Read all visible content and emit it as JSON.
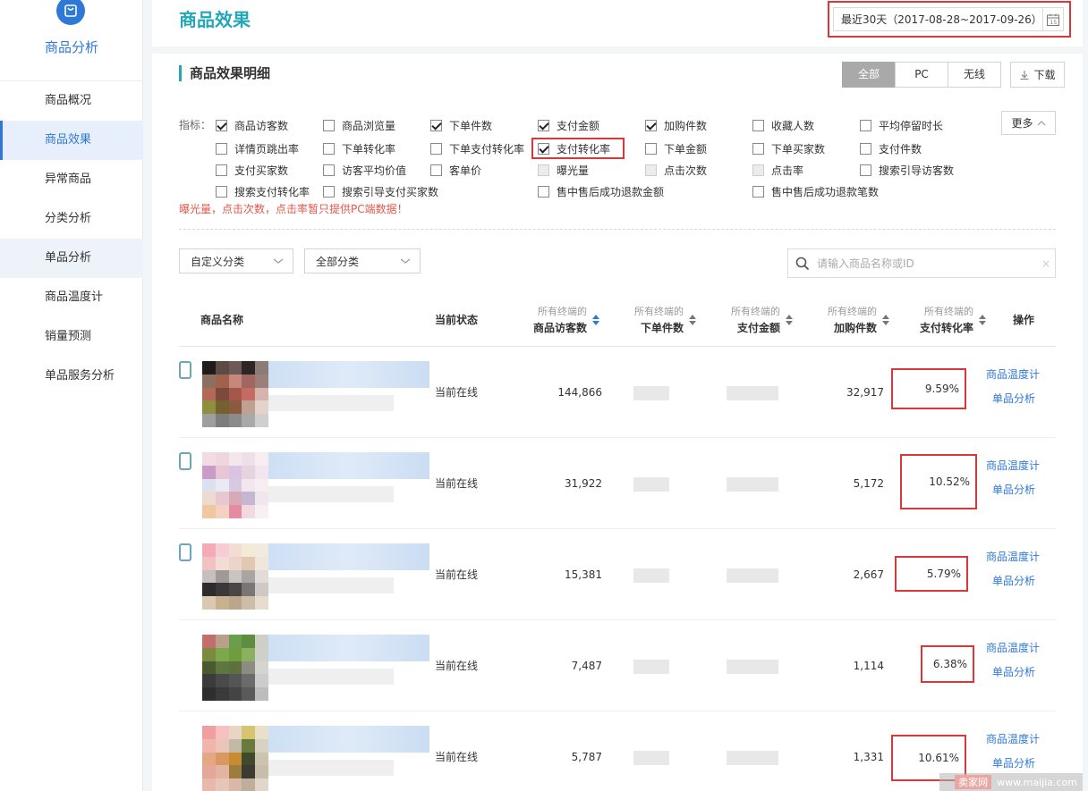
{
  "sidebar": {
    "title": "商品分析",
    "items": [
      {
        "label": "商品概况"
      },
      {
        "label": "商品效果"
      },
      {
        "label": "异常商品"
      },
      {
        "label": "分类分析"
      },
      {
        "label": "单品分析"
      },
      {
        "label": "商品温度计"
      },
      {
        "label": "销量预测"
      },
      {
        "label": "单品服务分析"
      }
    ]
  },
  "header": {
    "title": "商品效果",
    "date_range": "最近30天（2017-08-28~2017-09-26）"
  },
  "main": {
    "section_title": "商品效果明细",
    "segments": [
      "全部",
      "PC",
      "无线"
    ],
    "download_label": "下载",
    "indicator_label": "指标：",
    "more_label": "更多",
    "indicators": [
      {
        "label": "商品访客数",
        "checked": true
      },
      {
        "label": "商品浏览量",
        "checked": false
      },
      {
        "label": "下单件数",
        "checked": true
      },
      {
        "label": "支付金额",
        "checked": true
      },
      {
        "label": "加购件数",
        "checked": true
      },
      {
        "label": "收藏人数",
        "checked": false
      },
      {
        "label": "平均停留时长",
        "checked": false
      },
      {
        "label": "详情页跳出率",
        "checked": false
      },
      {
        "label": "下单转化率",
        "checked": false
      },
      {
        "label": "下单支付转化率",
        "checked": false
      },
      {
        "label": "支付转化率",
        "checked": true
      },
      {
        "label": "下单金额",
        "checked": false
      },
      {
        "label": "下单买家数",
        "checked": false
      },
      {
        "label": "支付件数",
        "checked": false
      },
      {
        "label": "支付买家数",
        "checked": false
      },
      {
        "label": "访客平均价值",
        "checked": false
      },
      {
        "label": "客单价",
        "checked": false
      },
      {
        "label": "曝光量",
        "checked": false,
        "disabled": true
      },
      {
        "label": "点击次数",
        "checked": false,
        "disabled": true
      },
      {
        "label": "点击率",
        "checked": false,
        "disabled": true
      },
      {
        "label": "搜索引导访客数",
        "checked": false
      },
      {
        "label": "搜索支付转化率",
        "checked": false
      },
      {
        "label": "搜索引导支付买家数",
        "checked": false
      },
      {
        "label": "售中售后成功退款金额",
        "checked": false
      },
      {
        "label": "售中售后成功退款笔数",
        "checked": false
      }
    ],
    "warning": "曝光量，点击次数，点击率暂只提供PC端数据！",
    "filter_custom": "自定义分类",
    "filter_all": "全部分类",
    "search_placeholder": "请输入商品名称或ID",
    "search_clear": "×"
  },
  "table": {
    "columns": {
      "name": "商品名称",
      "status": "当前状态",
      "metric_prefix": "所有终端的",
      "visitors": "商品访客数",
      "orders": "下单件数",
      "pay_amount": "支付金额",
      "cart": "加购件数",
      "pay_rate": "支付转化率",
      "ops": "操作"
    },
    "rows": [
      {
        "status": "当前在线",
        "visitors": "144,866",
        "cart": "32,917",
        "pay_rate": "9.59%",
        "op1": "商品温度计",
        "op2": "单品分析"
      },
      {
        "status": "当前在线",
        "visitors": "31,922",
        "cart": "5,172",
        "pay_rate": "10.52%",
        "op1": "商品温度计",
        "op2": "单品分析"
      },
      {
        "status": "当前在线",
        "visitors": "15,381",
        "cart": "2,667",
        "pay_rate": "5.79%",
        "op1": "商品温度计",
        "op2": "单品分析"
      },
      {
        "status": "当前在线",
        "visitors": "7,487",
        "cart": "1,114",
        "pay_rate": "6.38%",
        "op1": "商品温度计",
        "op2": "单品分析"
      },
      {
        "status": "当前在线",
        "visitors": "5,787",
        "cart": "1,331",
        "pay_rate": "10.61%",
        "op1": "商品温度计",
        "op2": "单品分析"
      }
    ]
  },
  "watermark": {
    "logo": "卖家网",
    "url": "www.maijia.com"
  },
  "colors": {
    "accent": "#2f78d8",
    "title_teal": "#23a7b7",
    "highlight_red": "#d9383a",
    "warning": "#e5574b"
  }
}
